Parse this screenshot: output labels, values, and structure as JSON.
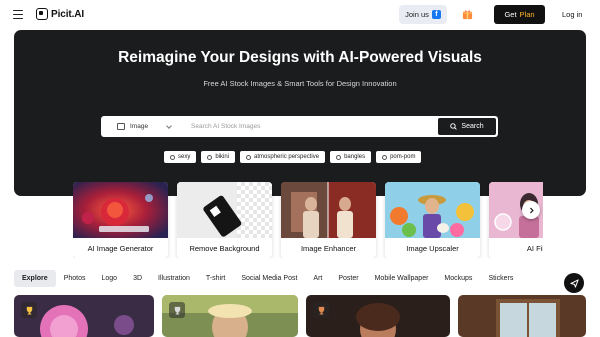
{
  "header": {
    "brand": "Picit.AI",
    "join_label": "Join us",
    "plan_label_1": "Get",
    "plan_label_2": "Plan",
    "login_label": "Log in",
    "icons": [
      "menu-icon",
      "facebook-icon",
      "gift-icon"
    ],
    "colors": {
      "plan_accent": "#ffb62a",
      "facebook": "#1877f2"
    }
  },
  "hero": {
    "title": "Reimagine Your Designs with AI-Powered Visuals",
    "subtitle": "Free AI Stock Images & Smart Tools for Design Innovation",
    "search": {
      "type_label": "Image",
      "placeholder": "Search AI Stock Images",
      "button_label": "Search"
    },
    "tags": [
      "sexy",
      "bikini",
      "atmospheric perspective",
      "bangles",
      "pom-pom"
    ],
    "colors": {
      "background": "#1b1c1e"
    }
  },
  "tools": [
    {
      "label": "AI Image Generator"
    },
    {
      "label": "Remove Background"
    },
    {
      "label": "Image Enhancer"
    },
    {
      "label": "Image Upscaler"
    },
    {
      "label": "AI Filt"
    }
  ],
  "categories": {
    "active": "Explore",
    "items": [
      "Explore",
      "Photos",
      "Logo",
      "3D",
      "Illustration",
      "T-shirt",
      "Social Media Post",
      "Art",
      "Poster",
      "Mobile Wallpaper",
      "Mockups",
      "Stickers"
    ]
  }
}
